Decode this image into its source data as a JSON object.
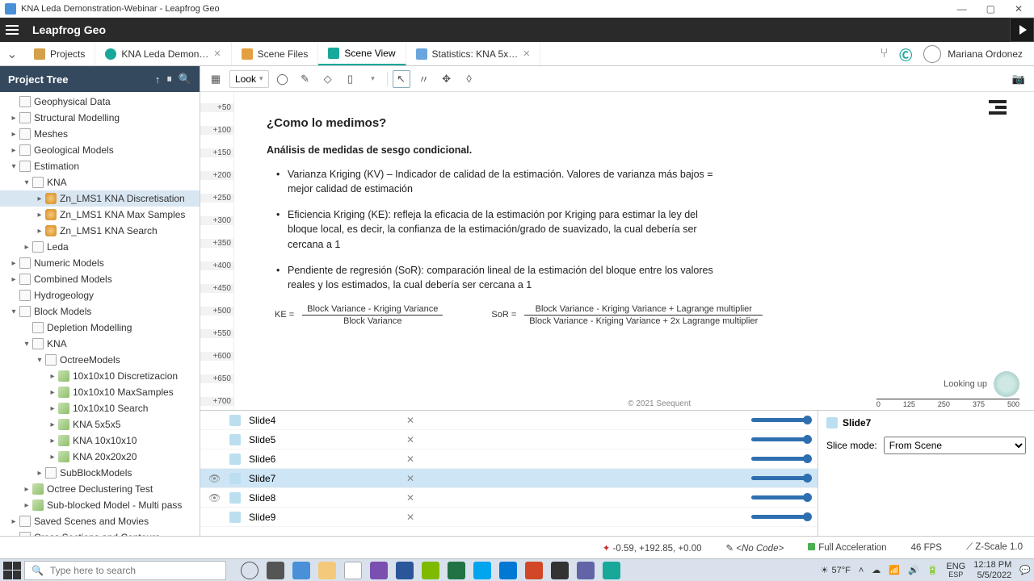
{
  "window": {
    "title": "KNA Leda Demonstration-Webinar - Leapfrog Geo"
  },
  "app": {
    "name": "Leapfrog Geo"
  },
  "tabs": {
    "projects": "Projects",
    "demo": "KNA Leda Demon…",
    "files": "Scene Files",
    "scene": "Scene View",
    "stats": "Statistics: KNA 5x…"
  },
  "user": {
    "name": "Mariana Ordonez"
  },
  "sidebar": {
    "title": "Project Tree",
    "items": {
      "geophys": "Geophysical Data",
      "struct": "Structural Modelling",
      "meshes": "Meshes",
      "geomod": "Geological Models",
      "estimation": "Estimation",
      "kna": "KNA",
      "kna_disc": "Zn_LMS1 KNA Discretisation",
      "kna_max": "Zn_LMS1 KNA Max Samples",
      "kna_search": "Zn_LMS1 KNA Search",
      "leda": "Leda",
      "numeric": "Numeric Models",
      "combined": "Combined Models",
      "hydro": "Hydrogeology",
      "block": "Block Models",
      "depletion": "Depletion Modelling",
      "bkna": "KNA",
      "octree": "OctreeModels",
      "oct_disc": "10x10x10 Discretizacion",
      "oct_max": "10x10x10 MaxSamples",
      "oct_search": "10x10x10 Search",
      "oct_5": "KNA 5x5x5",
      "oct_10": "KNA 10x10x10",
      "oct_20": "KNA 20x20x20",
      "subblock": "SubBlockModels",
      "declust": "Octree Declustering Test",
      "subblocked": "Sub-blocked Model - Multi pass",
      "scenes": "Saved Scenes and Movies",
      "cross": "Cross Sections and Contours"
    }
  },
  "toolbar": {
    "look": "Look"
  },
  "ruler": [
    "+50",
    "+100",
    "+150",
    "+200",
    "+250",
    "+300",
    "+350",
    "+400",
    "+450",
    "+500",
    "+550",
    "+600",
    "+650",
    "+700"
  ],
  "slide": {
    "title": "¿Como lo medimos?",
    "sub": "Análisis de medidas de sesgo condicional.",
    "b1": "Varianza Kriging (KV) – Indicador de calidad de la estimación.  Valores de varianza más bajos = mejor calidad de estimación",
    "b2": "Eficiencia Kriging (KE): refleja la eficacia de la estimación por Kriging para estimar la ley del bloque local, es decir, la confianza de la estimación/grado de suavizado, la cual debería ser cercana a 1",
    "b3": "Pendiente de regresión (SoR): comparación lineal de la estimación del bloque entre los valores reales y los estimados, la cual debería ser cercana a 1",
    "ke_label": "KE =",
    "ke_top": "Block Variance - Kriging Variance",
    "ke_bot": "Block Variance",
    "sor_label": "SoR =",
    "sor_top": "Block Variance - Kriging Variance + Lagrange multiplier",
    "sor_bot": "Block Variance - Kriging Variance + 2x Lagrange multiplier",
    "copy": "© 2021 Seequent",
    "compass": "Looking up"
  },
  "scale": {
    "t0": "0",
    "t1": "125",
    "t2": "250",
    "t3": "375",
    "t4": "500"
  },
  "slides": [
    "Slide4",
    "Slide5",
    "Slide6",
    "Slide7",
    "Slide8",
    "Slide9"
  ],
  "props": {
    "title": "Slide7",
    "mode_label": "Slice mode:",
    "mode_value": "From Scene"
  },
  "status": {
    "coords": "-0.59, +192.85, +0.00",
    "code": "<No Code>",
    "accel": "Full Acceleration",
    "fps": "46 FPS",
    "zscale": "Z-Scale 1.0"
  },
  "taskbar": {
    "search_placeholder": "Type here to search",
    "weather": "57°F",
    "lang": "ENG",
    "kb": "ESP",
    "time": "12:18 PM",
    "date": "5/5/2022"
  }
}
